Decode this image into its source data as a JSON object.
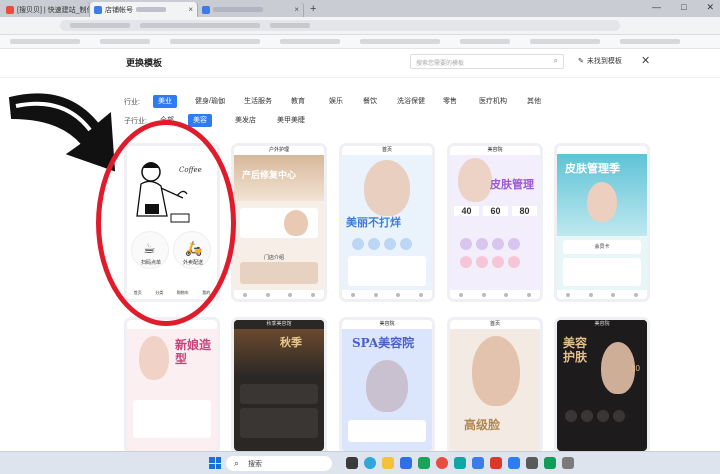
{
  "browser": {
    "tabs": [
      {
        "label": "[搜贝贝] | 快速建站_制作小程序",
        "active": false
      },
      {
        "label": "店铺帐号",
        "active": true
      },
      {
        "label": "",
        "active": false
      }
    ],
    "new_tab": "+",
    "win_controls": [
      "—",
      "□",
      "✕"
    ]
  },
  "modal": {
    "title": "更换模板",
    "search_placeholder": "搜索您需要的模板",
    "not_found_label": "未找到模板",
    "close": "✕"
  },
  "filters": {
    "industry_label": "行业:",
    "industries": [
      "美业",
      "健身/瑜伽",
      "生活服务",
      "教育",
      "娱乐",
      "餐饮",
      "洗浴保健",
      "零售",
      "医疗机构",
      "其他"
    ],
    "sub_label": "子行业:",
    "sub_industries": [
      "全部",
      "美容",
      "美发店",
      "美甲美睫"
    ]
  },
  "templates": [
    {
      "header": "",
      "title": "Coffee",
      "buttons": [
        "扫码点单",
        "外卖配送"
      ],
      "tabs": [
        "首页",
        "分类",
        "购物车",
        "我的"
      ]
    },
    {
      "header": "户外护理",
      "title": "产后修复中心",
      "sub": "门店介绍"
    },
    {
      "header": "首页",
      "title": "美丽不打烊"
    },
    {
      "header": "美容院",
      "title": "皮肤管理",
      "stats": [
        "40",
        "60",
        "80"
      ]
    },
    {
      "header": "",
      "title": "皮肤管理季",
      "sub": "会员卡"
    },
    {
      "header": "",
      "title": "新娘造型"
    },
    {
      "header": "秋季美容馆",
      "title": "秋季"
    },
    {
      "header": "美容院",
      "title": "SPA美容院"
    },
    {
      "header": "首页",
      "title": "高级脸"
    },
    {
      "header": "美容院",
      "title": "美容护肤",
      "num": "30"
    }
  ],
  "taskbar": {
    "search_label": "搜索"
  },
  "colors": {
    "accent": "#2f7bf0",
    "annotation": "#e01b2c"
  }
}
